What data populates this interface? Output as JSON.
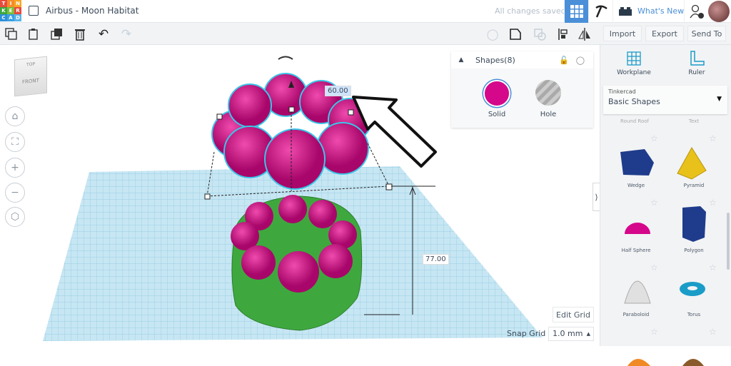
{
  "header": {
    "logo_letters": [
      "T",
      "I",
      "N",
      "K",
      "E",
      "R",
      "C",
      "A",
      "D"
    ],
    "title": "Airbus - Moon Habitat",
    "save_status": "All changes saved",
    "whats_new": "What's New"
  },
  "toolbar": {
    "import": "Import",
    "export": "Export",
    "send_to": "Send To"
  },
  "viewcube": {
    "top": "TOP",
    "front": "FRONT"
  },
  "scene": {
    "width_dim": "60.00",
    "height_dim": "77.00"
  },
  "shapes_panel": {
    "title": "Shapes(8)",
    "solid": "Solid",
    "hole": "Hole",
    "solid_color": "#d5078a"
  },
  "right_panel": {
    "workplane": "Workplane",
    "ruler": "Ruler",
    "library_source": "Tinkercad",
    "library": "Basic Shapes",
    "partial_labels": [
      "Round Roof",
      "Text"
    ],
    "shapes": [
      {
        "label": "Wedge",
        "color": "#1f3c8c"
      },
      {
        "label": "Pyramid",
        "color": "#e8c21a"
      },
      {
        "label": "Half Sphere",
        "color": "#d5078a"
      },
      {
        "label": "Polygon",
        "color": "#1f3c8c"
      },
      {
        "label": "Paraboloid",
        "color": "#d8d8d8"
      },
      {
        "label": "Torus",
        "color": "#1a9cc8"
      }
    ]
  },
  "grid": {
    "edit_grid": "Edit Grid",
    "snap_label": "Snap Grid",
    "snap_value": "1.0 mm"
  },
  "colors": {
    "accent": "#4a8fd8",
    "green": "#3ea83e",
    "pink": "#d5078a"
  }
}
